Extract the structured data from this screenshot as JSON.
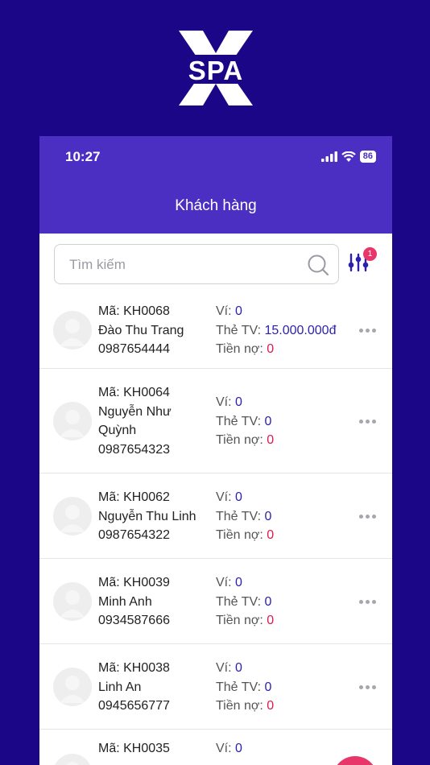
{
  "brand": {
    "logo_letter": "X",
    "logo_text": "SPA"
  },
  "status_bar": {
    "time": "10:27",
    "battery": "86"
  },
  "header": {
    "title": "Khách hàng"
  },
  "search": {
    "placeholder": "Tìm kiếm"
  },
  "filter": {
    "badge_count": "1"
  },
  "labels": {
    "code": "Mã:",
    "wallet": "Ví:",
    "card": "Thẻ TV:",
    "debt": "Tiền nợ:"
  },
  "customers": [
    {
      "code": "KH0068",
      "name": "Đào Thu Trang",
      "phone": "0987654444",
      "wallet": "0",
      "card": "15.000.000đ",
      "debt": "0"
    },
    {
      "code": "KH0064",
      "name": "Nguyễn Như Quỳnh",
      "phone": "0987654323",
      "wallet": "0",
      "card": "0",
      "debt": "0"
    },
    {
      "code": "KH0062",
      "name": "Nguyễn Thu Linh",
      "phone": "0987654322",
      "wallet": "0",
      "card": "0",
      "debt": "0"
    },
    {
      "code": "KH0039",
      "name": "Minh Anh",
      "phone": "0934587666",
      "wallet": "0",
      "card": "0",
      "debt": "0"
    },
    {
      "code": "KH0038",
      "name": "Linh An",
      "phone": "0945656777",
      "wallet": "0",
      "card": "0",
      "debt": "0"
    },
    {
      "code": "KH0035",
      "name": "",
      "phone": "",
      "wallet": "0",
      "card": "",
      "debt": ""
    }
  ],
  "colors": {
    "background": "#1c0688",
    "app_bar": "#4a2fc2",
    "accent_blue": "#2b1fb0",
    "accent_red": "#e0194b",
    "fab": "#e8366b"
  }
}
